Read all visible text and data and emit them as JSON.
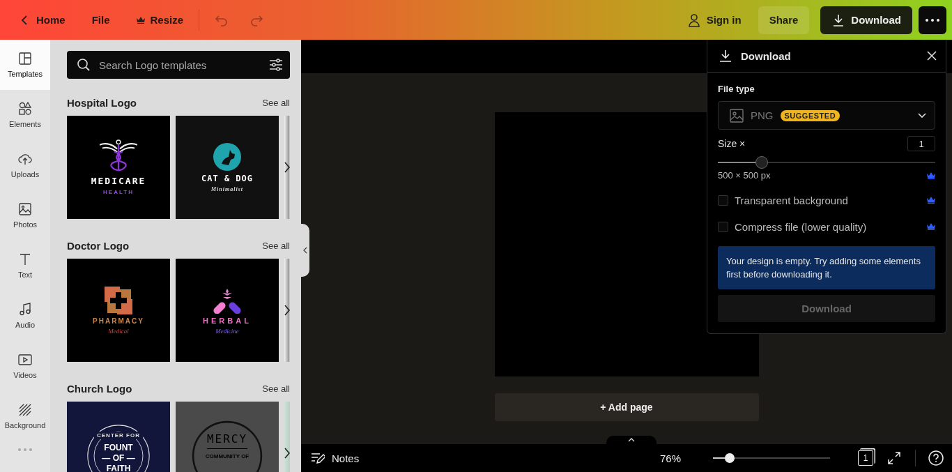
{
  "topbar": {
    "back": "Home",
    "menu": [
      "File"
    ],
    "resize": "Resize",
    "sign_in": "Sign in",
    "share": "Share",
    "download": "Download"
  },
  "rail": {
    "items": [
      {
        "label": "Templates",
        "kind": "templates",
        "selected": true
      },
      {
        "label": "Elements",
        "kind": "elements",
        "selected": false
      },
      {
        "label": "Uploads",
        "kind": "uploads",
        "selected": false
      },
      {
        "label": "Photos",
        "kind": "photos",
        "selected": false
      },
      {
        "label": "Text",
        "kind": "text",
        "selected": false
      },
      {
        "label": "Audio",
        "kind": "audio",
        "selected": false
      },
      {
        "label": "Videos",
        "kind": "videos",
        "selected": false
      },
      {
        "label": "Background",
        "kind": "background",
        "selected": false
      }
    ]
  },
  "panel": {
    "search": {
      "placeholder": "Search Logo templates"
    },
    "sections": [
      {
        "title": "Hospital Logo",
        "see_all": "See all",
        "templates": [
          {
            "kind": "medicare",
            "texts": [
              "MEDICARE",
              "HEALTH"
            ]
          },
          {
            "kind": "catdog",
            "texts": [
              "CAT & DOG",
              "Minimalist"
            ]
          },
          {
            "kind": "partial"
          }
        ]
      },
      {
        "title": "Doctor Logo",
        "see_all": "See all",
        "templates": [
          {
            "kind": "pharmacy",
            "texts": [
              "PHARMACY",
              "Medical"
            ]
          },
          {
            "kind": "herbal",
            "texts": [
              "HERBAL",
              "Medicine"
            ]
          },
          {
            "kind": "partial"
          }
        ]
      },
      {
        "title": "Church Logo",
        "see_all": "See all",
        "templates": [
          {
            "kind": "fount",
            "texts": [
              "CENTER FOR",
              "FOUNT",
              "— OF —",
              "FAITH"
            ]
          },
          {
            "kind": "mercy",
            "texts": [
              "MERCY",
              "COMMUNITY OF"
            ]
          },
          {
            "kind": "partial"
          }
        ]
      }
    ]
  },
  "canvas": {
    "add_page": "+ Add page"
  },
  "download_panel": {
    "title": "Download",
    "file_type_label": "File type",
    "file_type": "PNG",
    "badge": "SUGGESTED",
    "size_label": "Size ×",
    "size_value": "1",
    "size_slider": {
      "level": 0.2
    },
    "dimensions": "500 × 500 px",
    "options": [
      {
        "label": "Transparent background",
        "checked": false
      },
      {
        "label": "Compress file (lower quality)",
        "checked": false
      }
    ],
    "notice": "Your design is empty. Try adding some elements first before downloading it.",
    "button": "Download",
    "button_disabled": true
  },
  "bottom_bar": {
    "notes": "Notes",
    "zoom": "76%",
    "zoom_slider": {
      "level": 0.14
    },
    "page_count": "1"
  }
}
